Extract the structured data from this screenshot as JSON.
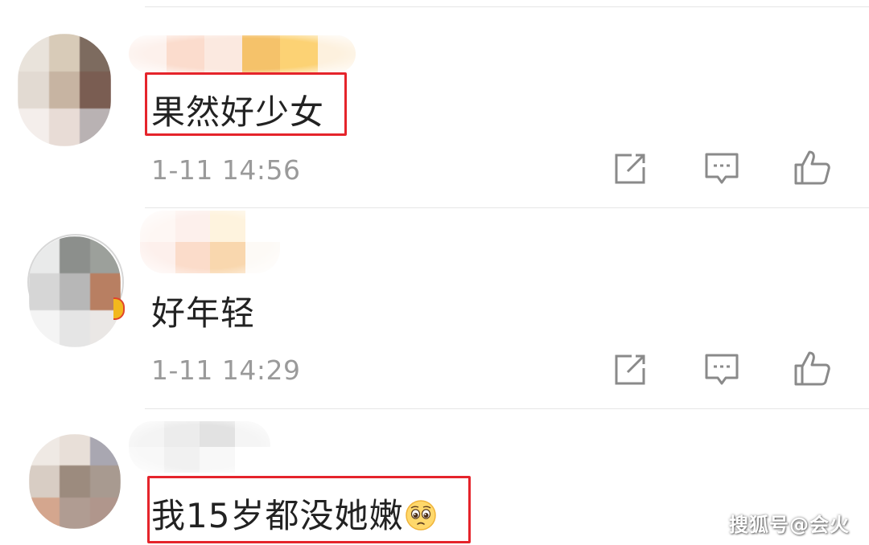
{
  "comments": [
    {
      "text": "果然好少女",
      "time": "1-11 14:56",
      "highlighted": true
    },
    {
      "text": "好年轻",
      "time": "1-11 14:29",
      "highlighted": false
    },
    {
      "text": "我15岁都没她嫩",
      "emoji": "pleading-face-emoji",
      "highlighted": true
    }
  ],
  "actions": {
    "share_icon": "share-icon",
    "reply_icon": "reply-comment-icon",
    "like_icon": "thumbs-up-icon"
  },
  "watermark": "搜狐号@会火",
  "colors": {
    "highlight": "#e5242b",
    "timestamp": "#9a9a9a",
    "text": "#222222"
  }
}
